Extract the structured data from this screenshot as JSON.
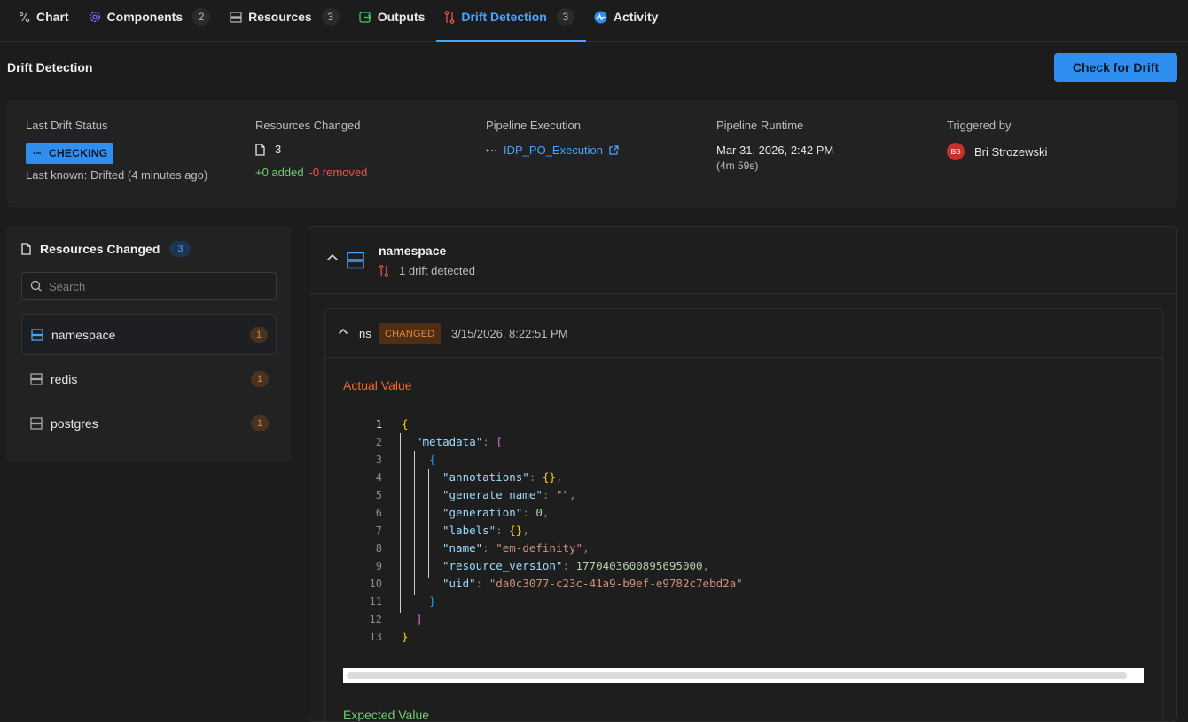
{
  "tabs": [
    {
      "label": "Chart",
      "count": null,
      "icon": "chart-icon"
    },
    {
      "label": "Components",
      "count": "2",
      "icon": "gear-icon"
    },
    {
      "label": "Resources",
      "count": "3",
      "icon": "server-icon"
    },
    {
      "label": "Outputs",
      "count": null,
      "icon": "output-icon"
    },
    {
      "label": "Drift Detection",
      "count": "3",
      "icon": "drift-icon",
      "active": true
    },
    {
      "label": "Activity",
      "count": null,
      "icon": "activity-icon"
    }
  ],
  "page": {
    "title": "Drift Detection",
    "check_button": "Check for Drift"
  },
  "summary": {
    "status_label": "Last Drift Status",
    "status_badge": "CHECKING",
    "status_sub": "Last known: Drifted (4 minutes ago)",
    "resources_label": "Resources Changed",
    "resources_count": "3",
    "added": "+0 added",
    "removed": "-0 removed",
    "pipeline_label": "Pipeline Execution",
    "pipeline_link": "IDP_PO_Execution",
    "runtime_label": "Pipeline Runtime",
    "runtime_value": "Mar 31, 2026, 2:42 PM",
    "runtime_duration": "(4m 59s)",
    "triggered_label": "Triggered by",
    "triggered_initials": "BS",
    "triggered_name": "Bri Strozewski"
  },
  "sidebar": {
    "title": "Resources Changed",
    "count": "3",
    "search_placeholder": "Search",
    "items": [
      {
        "label": "namespace",
        "count": "1",
        "selected": true
      },
      {
        "label": "redis",
        "count": "1"
      },
      {
        "label": "postgres",
        "count": "1"
      }
    ]
  },
  "detail": {
    "resource_name": "namespace",
    "drift_summary": "1 drift detected",
    "change": {
      "key": "ns",
      "badge": "CHANGED",
      "timestamp": "3/15/2026, 8:22:51 PM",
      "actual_label": "Actual Value",
      "expected_label": "Expected Value",
      "line_numbers": [
        "1",
        "2",
        "3",
        "4",
        "5",
        "6",
        "7",
        "8",
        "9",
        "10",
        "11",
        "12",
        "13"
      ],
      "code": {
        "l2_key": "\"metadata\"",
        "l4_key": "\"annotations\"",
        "l5_key": "\"generate_name\"",
        "l5_val": "\"\"",
        "l6_key": "\"generation\"",
        "l6_val": "0",
        "l7_key": "\"labels\"",
        "l8_key": "\"name\"",
        "l8_val": "\"em-definity\"",
        "l9_key": "\"resource_version\"",
        "l9_val": "1770403600895695000",
        "l10_key": "\"uid\"",
        "l10_val": "\"da0c3077-c23c-41a9-b9ef-e9782c7ebd2a\""
      }
    }
  },
  "colors": {
    "accent": "#2e8ff0",
    "link": "#4aa3ff",
    "added": "#6fd06f",
    "removed": "#f0524f",
    "changed": "#e0873c",
    "actual": "#f06a2c"
  }
}
